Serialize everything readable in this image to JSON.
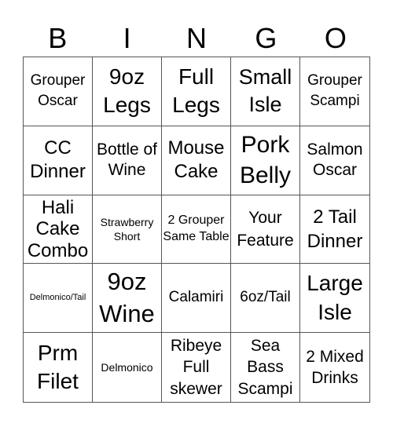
{
  "header": [
    "B",
    "I",
    "N",
    "G",
    "O"
  ],
  "cells": [
    "Grouper Oscar",
    "9oz Legs",
    "Full Legs",
    "Small Isle",
    "Grouper Scampi",
    "CC Dinner",
    "Bottle of Wine",
    "Mouse Cake",
    "Pork Belly",
    "Salmon Oscar",
    "Hali Cake Combo",
    "Strawberry Short",
    "2 Grouper Same Table",
    "Your Feature",
    "2 Tail Dinner",
    "Delmonico/Tail",
    "9oz Wine",
    "Calamiri",
    "6oz/Tail",
    "Large Isle",
    "Prm Filet",
    "Delmonico",
    "Ribeye Full skewer",
    "Sea Bass Scampi",
    "2 Mixed Drinks"
  ]
}
